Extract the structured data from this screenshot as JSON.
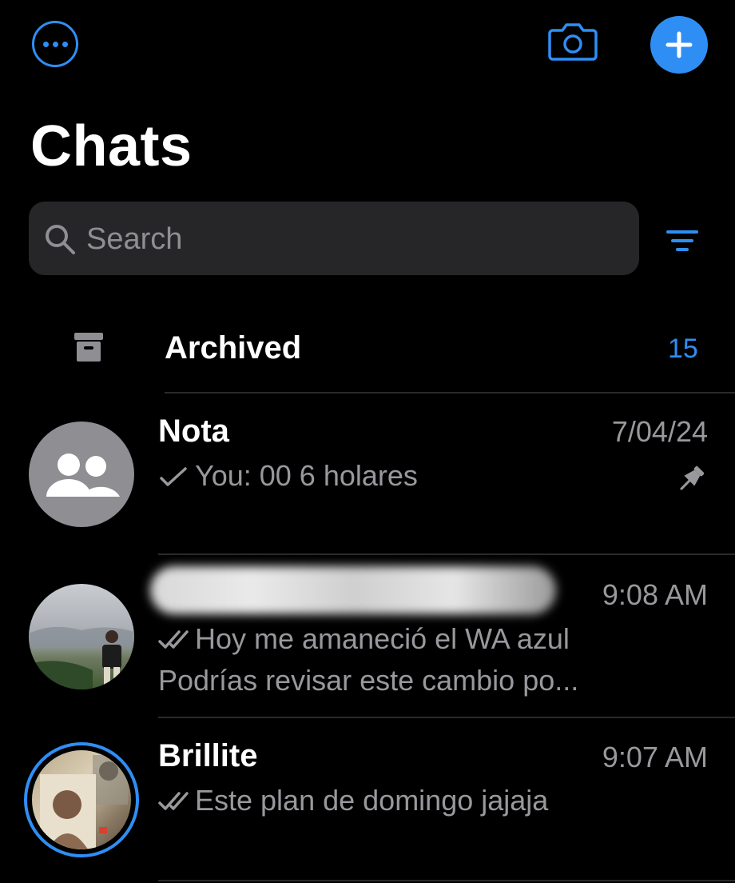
{
  "header": {
    "title": "Chats",
    "search_placeholder": "Search"
  },
  "icons": {
    "more": "ellipsis-circle-icon",
    "camera": "camera-icon",
    "new_chat": "plus-icon",
    "filter": "filter-icon",
    "archive": "archive-box-icon",
    "pin": "pin-icon",
    "read_receipt": "double-check-icon",
    "sent_receipt": "check-icon"
  },
  "archived": {
    "label": "Archived",
    "count": "15"
  },
  "chats": [
    {
      "name": "Nota",
      "time": "7/04/24",
      "preview": "You: 00 6 holares",
      "receipt": "sent",
      "pinned": true
    },
    {
      "name": "",
      "time": "9:08 AM",
      "preview": "Hoy me amaneció el WA azul",
      "preview2": "Podrías revisar este cambio po...",
      "receipt": "read"
    },
    {
      "name": "Brillite",
      "time": "9:07 AM",
      "preview": "Este plan de domingo jajaja",
      "receipt": "read",
      "has_status": true
    }
  ],
  "colors": {
    "accent": "#2f8ef4",
    "background": "#000000",
    "secondary_text": "#98989d",
    "search_field": "#262628"
  }
}
